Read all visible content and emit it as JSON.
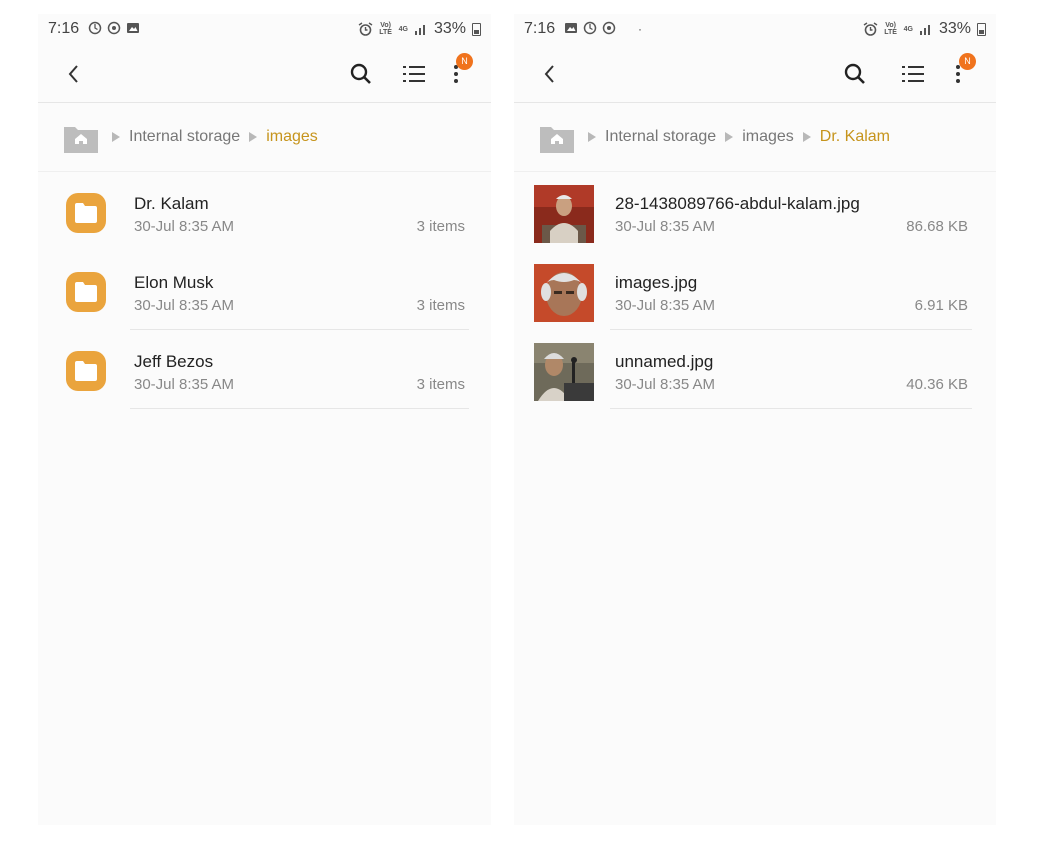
{
  "colors": {
    "accent": "#c6941c",
    "folder": "#eaa43d",
    "badge": "#f0731d",
    "background": "#fbfbfb"
  },
  "left": {
    "status": {
      "time": "7:16",
      "battery": "33%",
      "volte": "Vo) LTE",
      "network": "4G"
    },
    "toolbar": {
      "badge": "N"
    },
    "breadcrumb": {
      "root": "Internal storage",
      "current": "images"
    },
    "folders": [
      {
        "name": "Dr. Kalam",
        "date": "30-Jul 8:35 AM",
        "count": "3 items"
      },
      {
        "name": "Elon Musk",
        "date": "30-Jul 8:35 AM",
        "count": "3 items"
      },
      {
        "name": "Jeff Bezos",
        "date": "30-Jul 8:35 AM",
        "count": "3 items"
      }
    ]
  },
  "right": {
    "status": {
      "time": "7:16",
      "battery": "33%",
      "volte": "Vo) LTE",
      "network": "4G",
      "dot": "·"
    },
    "toolbar": {
      "badge": "N"
    },
    "breadcrumb": {
      "root": "Internal storage",
      "parent": "images",
      "current": "Dr. Kalam"
    },
    "files": [
      {
        "name": "28-1438089766-abdul-kalam.jpg",
        "date": "30-Jul 8:35 AM",
        "size": "86.68 KB"
      },
      {
        "name": "images.jpg",
        "date": "30-Jul 8:35 AM",
        "size": "6.91 KB"
      },
      {
        "name": "unnamed.jpg",
        "date": "30-Jul 8:35 AM",
        "size": "40.36 KB"
      }
    ]
  }
}
